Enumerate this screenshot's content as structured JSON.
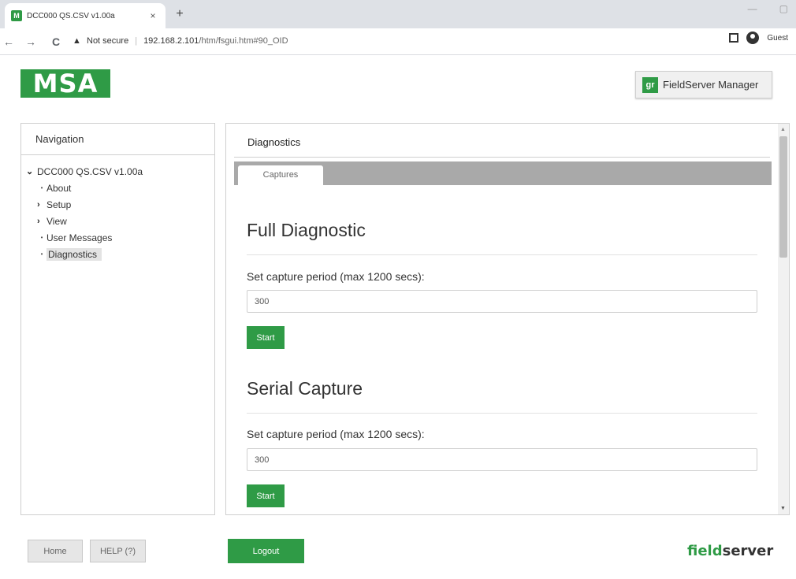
{
  "browser": {
    "tab_favicon": "M",
    "tab_title": "DCC000 QS.CSV v1.00a",
    "tab_close": "×",
    "new_tab": "+",
    "not_secure": "Not secure",
    "url_host": "192.168.2.101",
    "url_path": "/htm/fsgui.htm#90_OID",
    "profile_label": "Guest",
    "back_icon": "←",
    "forward_icon": "→",
    "reload_icon": "C",
    "warning_icon": "▲"
  },
  "header": {
    "logo_text": "MSA",
    "fsm_icon_text": "gr",
    "fsm_label": "FieldServer Manager"
  },
  "navigation": {
    "title": "Navigation",
    "root": {
      "label": "DCC000 QS.CSV v1.00a",
      "expanded": true
    },
    "items": [
      {
        "label": "About",
        "type": "leaf"
      },
      {
        "label": "Setup",
        "type": "folder"
      },
      {
        "label": "View",
        "type": "folder"
      },
      {
        "label": "User Messages",
        "type": "leaf"
      },
      {
        "label": "Diagnostics",
        "type": "leaf",
        "selected": true
      }
    ]
  },
  "main": {
    "title": "Diagnostics",
    "tab_label": "Captures",
    "sections": [
      {
        "heading": "Full Diagnostic",
        "label": "Set capture period (max 1200 secs):",
        "value": "300",
        "button": "Start"
      },
      {
        "heading": "Serial Capture",
        "label": "Set capture period (max 1200 secs):",
        "value": "300",
        "button": "Start"
      }
    ]
  },
  "footer": {
    "home_label": "Home",
    "help_label": "HELP (?)",
    "logout_label": "Logout",
    "brand_part1": "field",
    "brand_part2": "server"
  },
  "colors": {
    "brand_green": "#2f9b46",
    "tabbar_gray": "#a9a9a9",
    "selected_nav_bg": "#e3e3e3"
  }
}
